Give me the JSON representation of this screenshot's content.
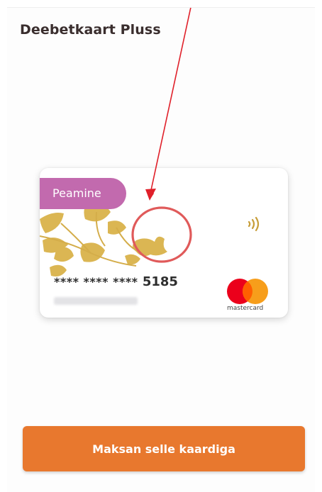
{
  "header": {
    "title": "Deebetkaart Pluss"
  },
  "card": {
    "badge": "Peamine",
    "number_masked": "**** **** ****",
    "last4": "5185",
    "network_label": "mastercard"
  },
  "actions": {
    "pay_label": "Maksan selle kaardiga"
  },
  "colors": {
    "badge": "#c26aae",
    "leaf_gold": "#dbb653",
    "button": "#e8782e",
    "annotation_red": "#e0202a",
    "mc_red": "#eb001b",
    "mc_orange": "#f79e1b"
  }
}
